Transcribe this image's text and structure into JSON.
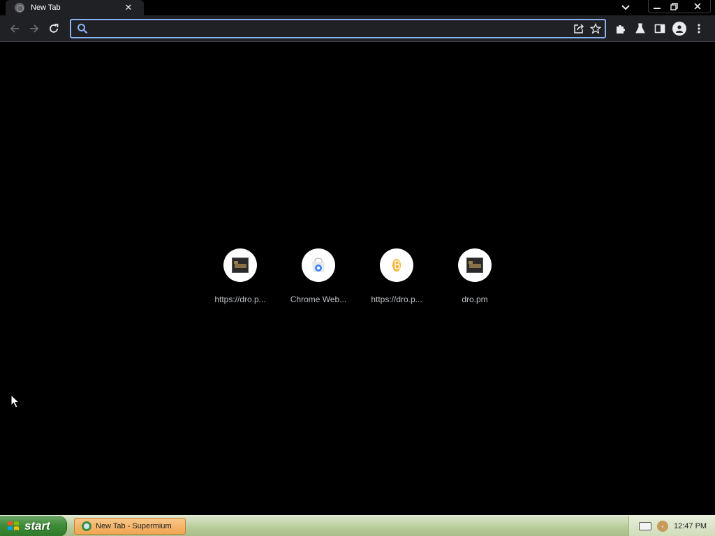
{
  "browser": {
    "tab": {
      "title": "New Tab",
      "close_glyph": "✕",
      "favicon": "globe-icon"
    },
    "omnibox": {
      "value": "",
      "placeholder": ""
    },
    "icons": [
      "back-arrow-icon",
      "forward-arrow-icon",
      "reload-icon",
      "share-icon",
      "bookmark-star-icon",
      "extensions-puzzle-icon",
      "labs-flask-icon",
      "side-panel-icon",
      "profile-icon",
      "menu-kebab-icon"
    ]
  },
  "shortcuts": [
    {
      "label": "https://dro.p...",
      "icon": "dro-pm-favicon"
    },
    {
      "label": "Chrome Web...",
      "icon": "chrome-web-store-icon"
    },
    {
      "label": "https://dro.p...",
      "icon": "coin-favicon"
    },
    {
      "label": "dro.pm",
      "icon": "dro-pm-favicon"
    }
  ],
  "taskbar": {
    "start_label": "start",
    "task_button_label": "New Tab - Supermium",
    "clock": "12:47 PM"
  },
  "colors": {
    "accent": "#8ab4f8",
    "toolbar": "#202124",
    "background": "#000000",
    "taskbar": "#c3d4a8",
    "start_button": "#3e8c38"
  }
}
